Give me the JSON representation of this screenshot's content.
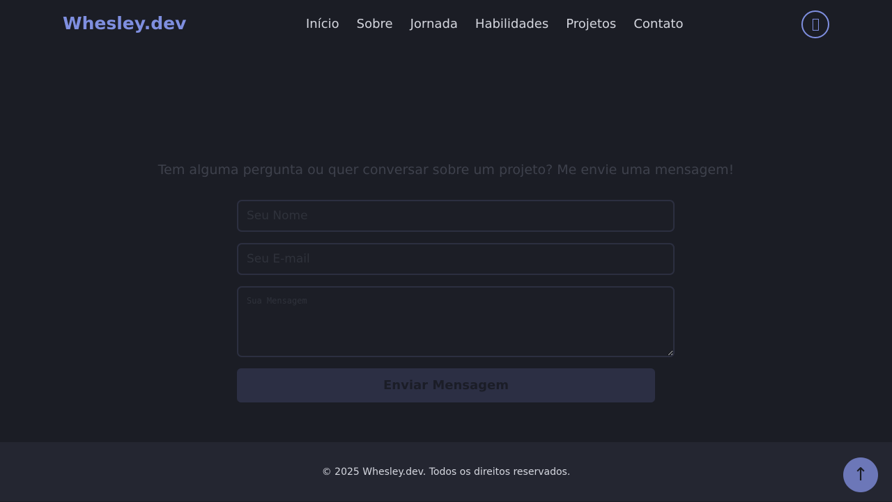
{
  "header": {
    "logo": "Whesley.dev",
    "nav": [
      "Início",
      "Sobre",
      "Jornada",
      "Habilidades",
      "Projetos",
      "Contato"
    ],
    "theme_icon": "missing-glyph-icon"
  },
  "contact": {
    "intro": "Tem alguma pergunta ou quer conversar sobre um projeto? Me envie uma mensagem!",
    "name_placeholder": "Seu Nome",
    "email_placeholder": "Seu E-mail",
    "message_placeholder": "Sua Mensagem",
    "submit": "Enviar Mensagem"
  },
  "footer": {
    "text": "© 2025 Whesley.dev. Todos os direitos reservados.",
    "back_to_top": "↑"
  },
  "colors": {
    "accent": "#7f8fe0",
    "background": "#1b1d25"
  }
}
